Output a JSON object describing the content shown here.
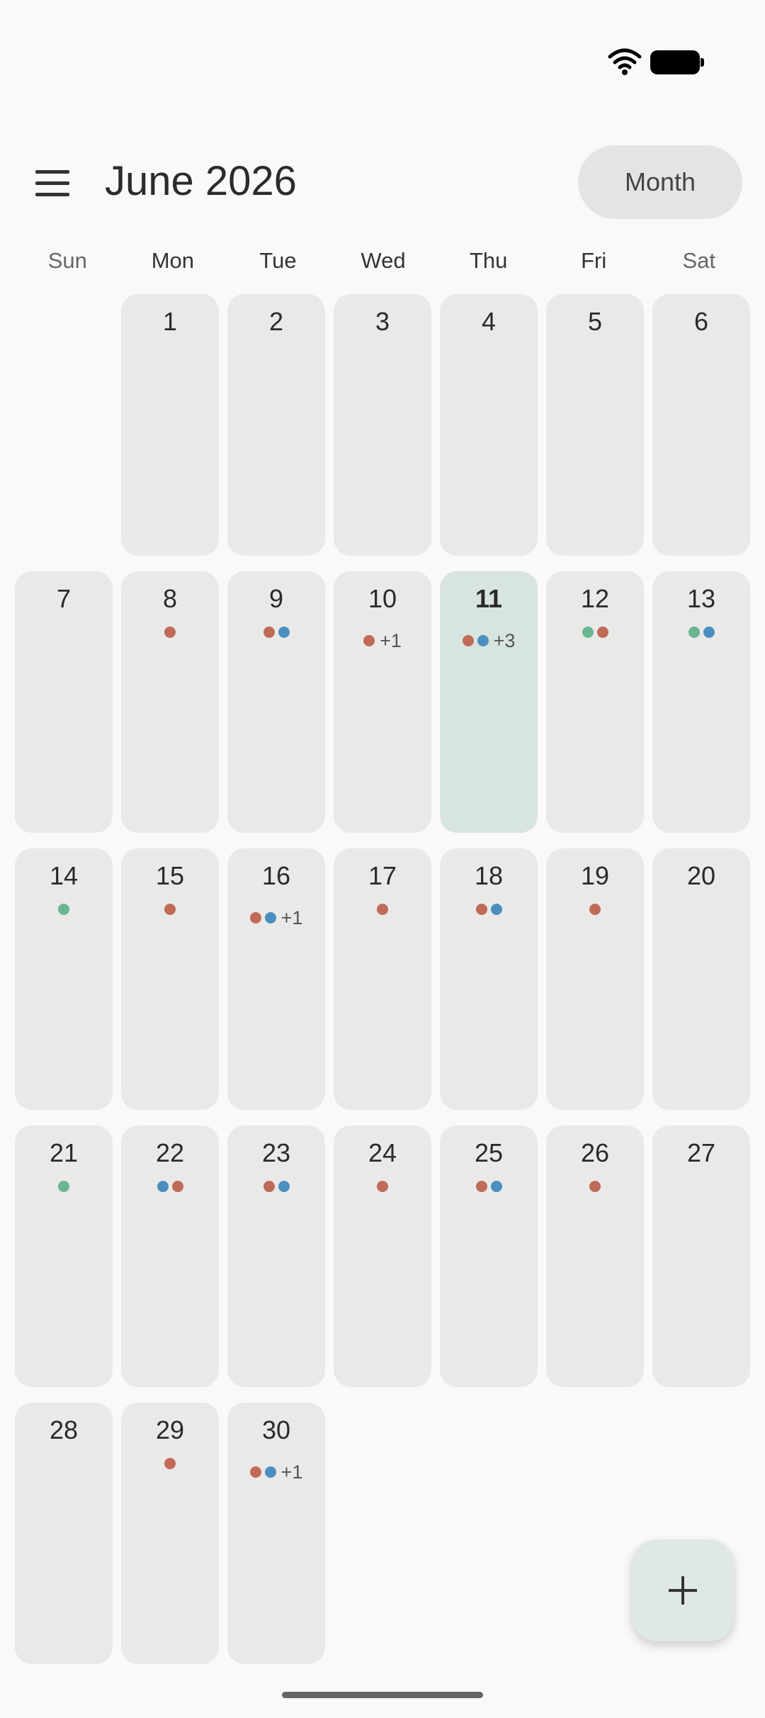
{
  "header": {
    "title": "June 2026",
    "view_label": "Month"
  },
  "weekdays": [
    "Sun",
    "Mon",
    "Tue",
    "Wed",
    "Thu",
    "Fri",
    "Sat"
  ],
  "colors": {
    "red": "#c06a58",
    "blue": "#4a8fc0",
    "green": "#6ab592",
    "today_bg": "#d8e4df",
    "cell_bg": "#e9e9e8"
  },
  "today": 11,
  "days": [
    {
      "day": "1",
      "dots": []
    },
    {
      "day": "2",
      "dots": []
    },
    {
      "day": "3",
      "dots": []
    },
    {
      "day": "4",
      "dots": []
    },
    {
      "day": "5",
      "dots": []
    },
    {
      "day": "6",
      "dots": []
    },
    {
      "day": "7",
      "dots": []
    },
    {
      "day": "8",
      "dots": [
        "red"
      ]
    },
    {
      "day": "9",
      "dots": [
        "red",
        "blue"
      ]
    },
    {
      "day": "10",
      "dots": [
        "red"
      ],
      "more": "+1"
    },
    {
      "day": "11",
      "dots": [
        "red",
        "blue"
      ],
      "more": "+3"
    },
    {
      "day": "12",
      "dots": [
        "green",
        "red"
      ]
    },
    {
      "day": "13",
      "dots": [
        "green",
        "blue"
      ]
    },
    {
      "day": "14",
      "dots": [
        "green"
      ]
    },
    {
      "day": "15",
      "dots": [
        "red"
      ]
    },
    {
      "day": "16",
      "dots": [
        "red",
        "blue"
      ],
      "more": "+1"
    },
    {
      "day": "17",
      "dots": [
        "red"
      ]
    },
    {
      "day": "18",
      "dots": [
        "red",
        "blue"
      ]
    },
    {
      "day": "19",
      "dots": [
        "red"
      ]
    },
    {
      "day": "20",
      "dots": []
    },
    {
      "day": "21",
      "dots": [
        "green"
      ]
    },
    {
      "day": "22",
      "dots": [
        "blue",
        "red"
      ]
    },
    {
      "day": "23",
      "dots": [
        "red",
        "blue"
      ]
    },
    {
      "day": "24",
      "dots": [
        "red"
      ]
    },
    {
      "day": "25",
      "dots": [
        "red",
        "blue"
      ]
    },
    {
      "day": "26",
      "dots": [
        "red"
      ]
    },
    {
      "day": "27",
      "dots": []
    },
    {
      "day": "28",
      "dots": []
    },
    {
      "day": "29",
      "dots": [
        "red"
      ]
    },
    {
      "day": "30",
      "dots": [
        "red",
        "blue"
      ],
      "more": "+1"
    }
  ],
  "first_weekday_index": 1,
  "icons": {
    "menu": "menu-icon",
    "add": "plus-icon",
    "wifi": "wifi-icon",
    "battery": "battery-icon"
  }
}
